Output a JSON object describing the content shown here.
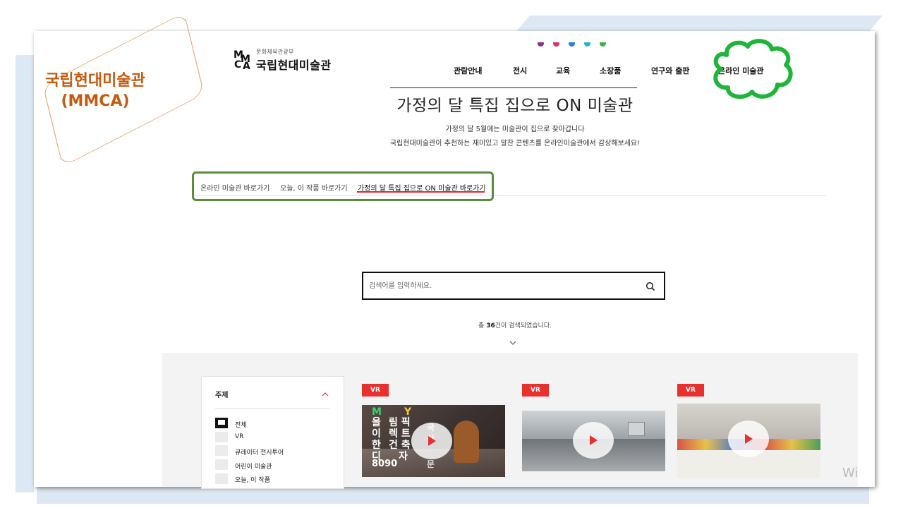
{
  "annotation": {
    "line1": "국립현대미술관",
    "line2": "(MMCA)"
  },
  "header": {
    "logo_letters": [
      "M",
      "M",
      "C",
      "A"
    ],
    "logo_sub": "문화체육관광부",
    "logo_main": "국립현대미술관",
    "nav": [
      "관람안내",
      "전시",
      "교육",
      "소장품",
      "연구와 출판",
      "온라인 미술관"
    ],
    "dot_colors": [
      "#8a2f8f",
      "#d6306a",
      "#2a7be4",
      "#25b3d8",
      "#3cb34a"
    ]
  },
  "page": {
    "title": "가정의 달 특집 집으로 ON 미술관",
    "intro_line1": "가정의 달 5월에는 미술관이 집으로 찾아갑니다",
    "intro_line2": "국립현대미술관이 추천하는 재미있고 알찬 콘텐츠를 온라인미술관에서 감상해보세요!"
  },
  "tabs": [
    "온라인 미술관 바로가기",
    "오늘, 이 작품 바로가기",
    "가정의 달 특집 집으로 ON 미술관 바로가기"
  ],
  "search": {
    "placeholder": "검색어를 입력하세요.",
    "count_prefix": "총 ",
    "count_number": "36",
    "count_suffix": "건이 검색되었습니다."
  },
  "filter": {
    "title": "주제",
    "options": [
      "전체",
      "VR",
      "큐레이터 전시투어",
      "어린이 미술관",
      "오늘, 이 작품"
    ],
    "selected": "전체"
  },
  "cards": [
    {
      "badge": "VR",
      "thumb_text_left": [
        "M",
        "올",
        "이",
        "한",
        "디",
        "8090"
      ],
      "thumb_text_right": [
        "Y",
        "림  픽",
        "렉  트",
        "건  축",
        "자"
      ],
      "thumb_text_right2": [
        "국",
        "산",
        "문"
      ]
    },
    {
      "badge": "VR"
    },
    {
      "badge": "VR"
    }
  ],
  "colors": {
    "accent_red": "#e8302f",
    "annotation": "#c55a11",
    "highlight_green": "#5b8c3c",
    "cloud_green": "#1fb53a"
  },
  "watermark": "Wi"
}
